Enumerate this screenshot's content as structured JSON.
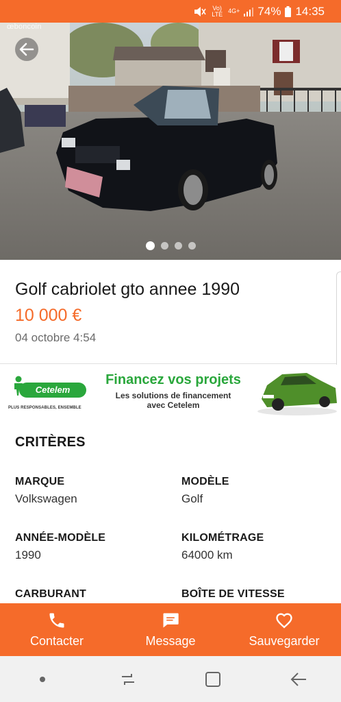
{
  "status_bar": {
    "network_small": "Vo) LTE",
    "network_type": "4G+",
    "battery": "74%",
    "time": "14:35"
  },
  "photo": {
    "watermark": "œboncoin",
    "page_count": 4,
    "active_page": 1
  },
  "ad": {
    "title": "Golf cabriolet gto annee 1990",
    "price": "10 000 €",
    "date": "04 octobre 4:54"
  },
  "banner": {
    "brand": "Cetelem",
    "tagline": "PLUS RESPONSABLES, ENSEMBLE",
    "headline": "Financez vos projets",
    "subline_1": "Les solutions de financement",
    "subline_2": "avec Cetelem"
  },
  "criteria": {
    "title": "CRITÈRES",
    "items": [
      {
        "label": "MARQUE",
        "value": "Volkswagen"
      },
      {
        "label": "MODÈLE",
        "value": "Golf"
      },
      {
        "label": "ANNÉE-MODÈLE",
        "value": "1990"
      },
      {
        "label": "KILOMÉTRAGE",
        "value": "64000 km"
      },
      {
        "label": "CARBURANT",
        "value": ""
      },
      {
        "label": "BOÎTE DE VITESSE",
        "value": ""
      }
    ]
  },
  "actions": {
    "contact": "Contacter",
    "message": "Message",
    "save": "Sauvegarder"
  },
  "colors": {
    "brand_orange": "#f56b2a",
    "cetelem_green": "#2aa73c"
  },
  "icons": {
    "back": "arrow-left-icon",
    "phone": "phone-icon",
    "message": "chat-bubble-icon",
    "save": "heart-outline-icon"
  }
}
